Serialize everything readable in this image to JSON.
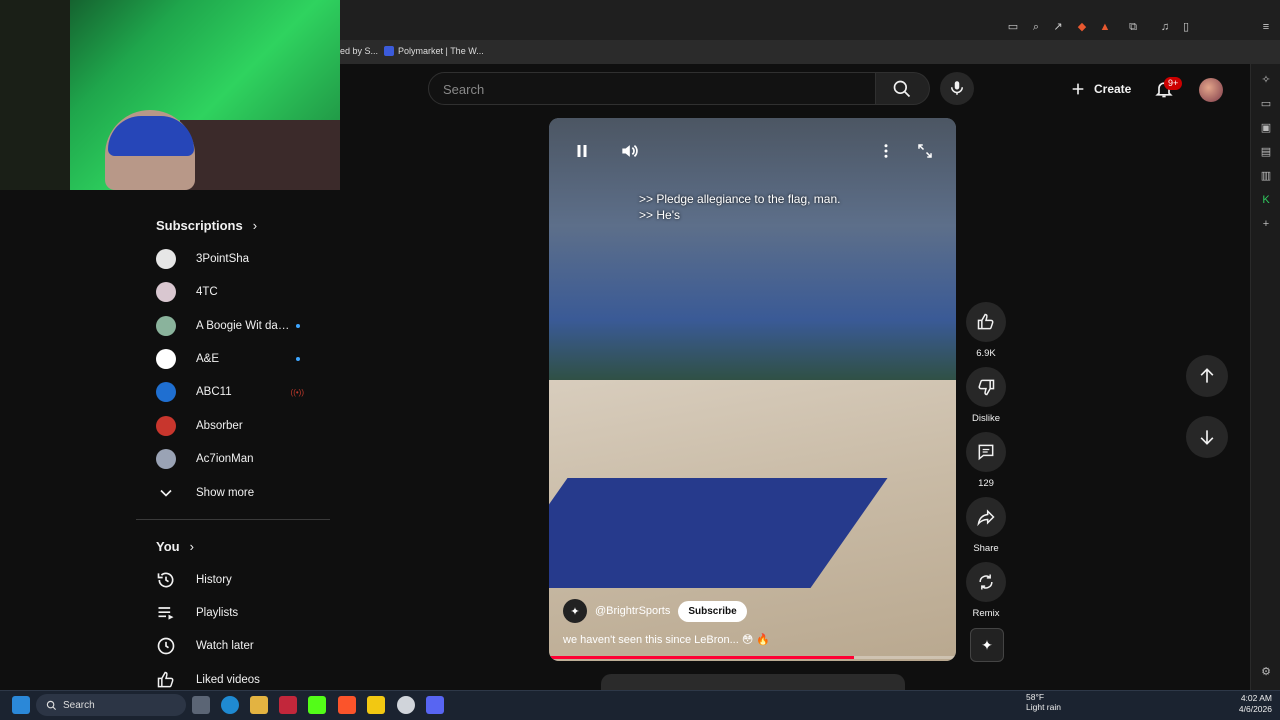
{
  "browser": {
    "bookmarks": [
      {
        "label": "ed by S..."
      },
      {
        "label": "Polymarket | The W..."
      }
    ]
  },
  "topbar": {
    "search_placeholder": "Search",
    "create_label": "Create",
    "notification_count": "9+"
  },
  "guide": {
    "subscriptions_title": "Subscriptions",
    "subscriptions": [
      {
        "label": "3PointSha",
        "indicator": "",
        "color": "#e6e6e6"
      },
      {
        "label": "4TC",
        "indicator": "",
        "color": "#d9c7d0"
      },
      {
        "label": "A Boogie Wit da ...",
        "indicator": "dot",
        "color": "#8ab39c"
      },
      {
        "label": "A&E",
        "indicator": "dot",
        "color": "#ffffff"
      },
      {
        "label": "ABC11",
        "indicator": "live",
        "color": "#1f6fd1"
      },
      {
        "label": "Absorber",
        "indicator": "",
        "color": "#c8362d"
      },
      {
        "label": "Ac7ionMan",
        "indicator": "",
        "color": "#9aa3b5"
      }
    ],
    "show_more_label": "Show more",
    "you_title": "You",
    "you_items": [
      {
        "label": "History",
        "icon": "history-icon"
      },
      {
        "label": "Playlists",
        "icon": "playlists-icon"
      },
      {
        "label": "Watch later",
        "icon": "watch-later-icon"
      },
      {
        "label": "Liked videos",
        "icon": "liked-videos-icon"
      }
    ]
  },
  "short": {
    "captions": [
      ">> Pledge allegiance to the flag, man.",
      ">> He's"
    ],
    "channel": "@BrightrSports",
    "subscribe_label": "Subscribe",
    "title": "we haven't seen this since LeBron... 😳 🔥",
    "progress": 0.75
  },
  "actions": {
    "likes": "6.9K",
    "dislike_label": "Dislike",
    "comments": "129",
    "share_label": "Share",
    "remix_label": "Remix"
  },
  "taskbar": {
    "search_label": "Search",
    "weather_temp": "58°F",
    "weather_desc": "Light rain",
    "time": "4:02 AM",
    "date": "4/6/2026"
  }
}
